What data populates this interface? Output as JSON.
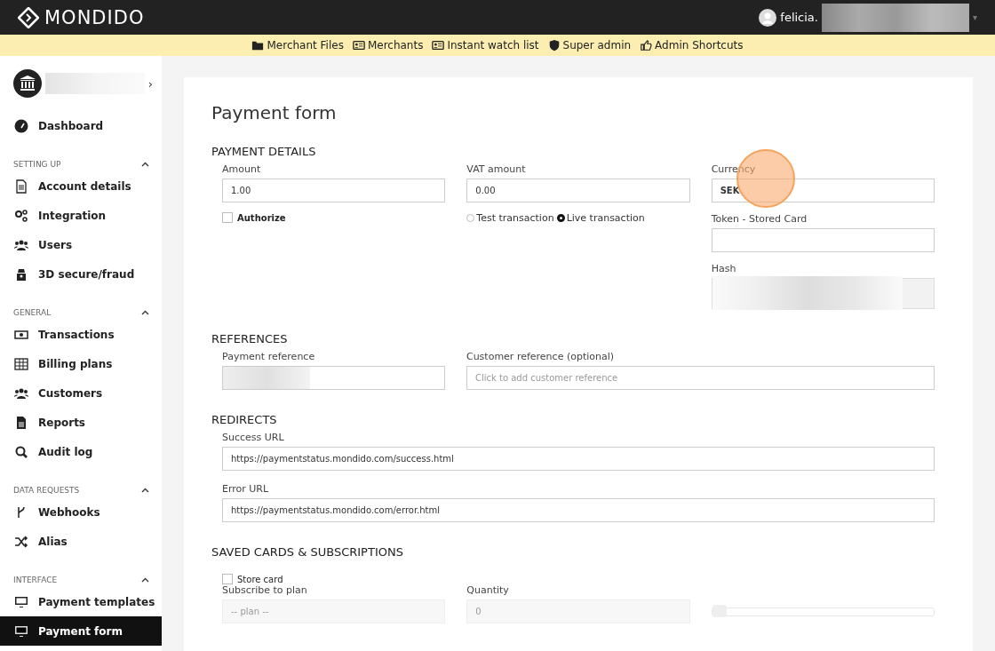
{
  "header": {
    "logo": "MONDIDO",
    "user": "felicia.",
    "caret": "▾"
  },
  "nav": [
    {
      "label": "Merchant Files"
    },
    {
      "label": "Merchants"
    },
    {
      "label": "Instant watch list"
    },
    {
      "label": "Super admin"
    },
    {
      "label": "Admin Shortcuts"
    }
  ],
  "sidebar": {
    "account_chevron": "›",
    "top_items": [
      {
        "label": "Dashboard",
        "selected": false
      }
    ],
    "sections": [
      {
        "title": "SETTING UP",
        "expanded": true,
        "items": [
          {
            "label": "Account details",
            "selected": false
          },
          {
            "label": "Integration",
            "selected": false
          },
          {
            "label": "Users",
            "selected": false
          },
          {
            "label": "3D secure/fraud",
            "selected": false
          }
        ]
      },
      {
        "title": "GENERAL",
        "expanded": true,
        "items": [
          {
            "label": "Transactions",
            "selected": false
          },
          {
            "label": "Billing plans",
            "selected": false
          },
          {
            "label": "Customers",
            "selected": false
          },
          {
            "label": "Reports",
            "selected": false
          },
          {
            "label": "Audit log",
            "selected": false
          }
        ]
      },
      {
        "title": "DATA REQUESTS",
        "expanded": true,
        "items": [
          {
            "label": "Webhooks",
            "selected": false
          },
          {
            "label": "Alias",
            "selected": false
          }
        ]
      },
      {
        "title": "INTERFACE",
        "expanded": true,
        "items": [
          {
            "label": "Payment templates",
            "selected": false
          },
          {
            "label": "Payment form",
            "selected": true
          }
        ]
      }
    ]
  },
  "form": {
    "title": "Payment form",
    "payment_details": {
      "heading": "PAYMENT DETAILS",
      "amount": {
        "label": "Amount",
        "value": "1.00"
      },
      "vat": {
        "label": "VAT amount",
        "value": "0.00"
      },
      "currency": {
        "label": "Currency",
        "value": "SEK"
      },
      "authorize": {
        "label": "Authorize",
        "checked": false
      },
      "transaction_modes": [
        {
          "label": "Test transaction",
          "selected": false
        },
        {
          "label": "Live transaction",
          "selected": true
        }
      ],
      "token": {
        "label": "Token - Stored Card"
      },
      "hash": {
        "label": "Hash"
      }
    },
    "references": {
      "heading": "REFERENCES",
      "payment_reference": {
        "label": "Payment reference"
      },
      "customer_reference": {
        "label": "Customer reference (optional)",
        "placeholder": "Click to add customer reference"
      }
    },
    "redirects": {
      "heading": "REDIRECTS",
      "success": {
        "label": "Success URL",
        "value": "https://paymentstatus.mondido.com/success.html"
      },
      "error": {
        "label": "Error URL",
        "value": "https://paymentstatus.mondido.com/error.html"
      }
    },
    "saved": {
      "heading": "SAVED CARDS & SUBSCRIPTIONS",
      "store_card": {
        "label": "Store card",
        "checked": false
      },
      "plan": {
        "label": "Subscribe to plan",
        "placeholder": "-- plan --"
      },
      "quantity": {
        "label": "Quantity",
        "placeholder": "0"
      },
      "slider": {
        "level": 0
      }
    }
  }
}
